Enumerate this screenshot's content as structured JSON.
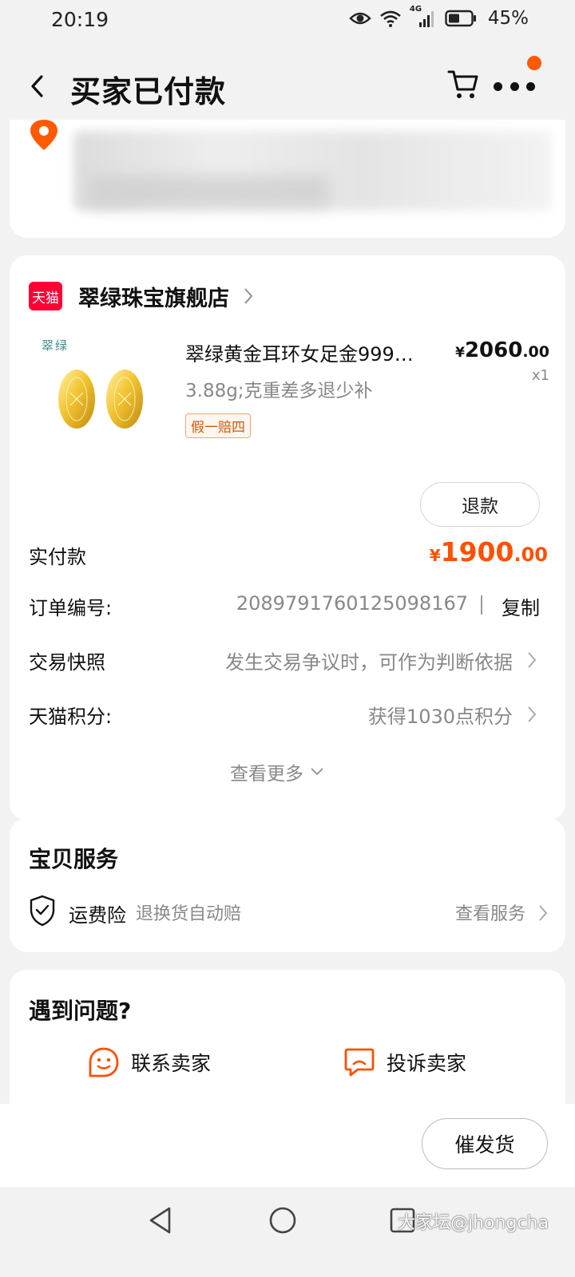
{
  "status_bar": {
    "time": "20:19",
    "network": "4G",
    "battery": "45%"
  },
  "nav": {
    "title": "买家已付款",
    "icons": [
      "back-arrow-icon",
      "cart-icon",
      "more-icon"
    ]
  },
  "store": {
    "platform_badge": "天猫",
    "name": "翠绿珠宝旗舰店"
  },
  "product": {
    "brand_mark": "翠绿",
    "title": "翠绿黄金耳环女足金999…",
    "spec": "3.88g;克重差多退少补",
    "tag": "假一赔四",
    "price_symbol": "¥",
    "price_int": "2060",
    "price_dec": ".00",
    "quantity": "x1"
  },
  "actions": {
    "refund": "退款",
    "urge_shipping": "催发货"
  },
  "payment": {
    "label": "实付款",
    "symbol": "¥",
    "amount_int": "1900",
    "amount_dec": ".00"
  },
  "order_info": {
    "order_no_label": "订单编号:",
    "order_no": "2089791760125098167",
    "copy": "复制",
    "snapshot_label": "交易快照",
    "snapshot_value": "发生交易争议时，可作为判断依据",
    "points_label": "天猫积分:",
    "points_value": "获得1030点积分",
    "see_more": "查看更多"
  },
  "services": {
    "title": "宝贝服务",
    "item_name": "运费险",
    "item_desc": "退换货自动赔",
    "view": "查看服务"
  },
  "help": {
    "title": "遇到问题?",
    "contact": "联系卖家",
    "complain": "投诉卖家"
  },
  "watermark": "大家坛@jhongcha",
  "colors": {
    "accent": "#ff5000",
    "tmall_red": "#ff0036",
    "background": "#f2f2f2"
  }
}
